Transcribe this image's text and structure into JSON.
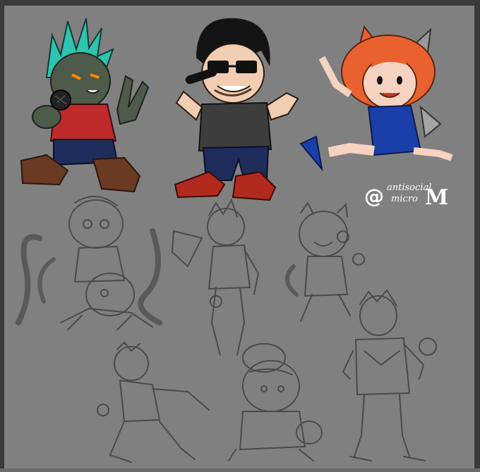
{
  "signature": {
    "at": "@",
    "line1": "antisocial",
    "line2": "micro",
    "mark": "M"
  },
  "colors": {
    "canvas_bg": "#808080",
    "frame": "#3a3a3a",
    "sketch_line": "#4a4a4a",
    "teal_hair": "#2ec4b0",
    "red_shirt": "#c02a2a",
    "navy_pants": "#1f2d5c",
    "brown_boots": "#6b3a22",
    "black_hair": "#141414",
    "gray_shirt": "#3d3d3d",
    "red_shoes": "#b22a1e",
    "orange_hair": "#e8612e",
    "blue_dress": "#1a3fa8",
    "skin": "#f6d2c0"
  }
}
